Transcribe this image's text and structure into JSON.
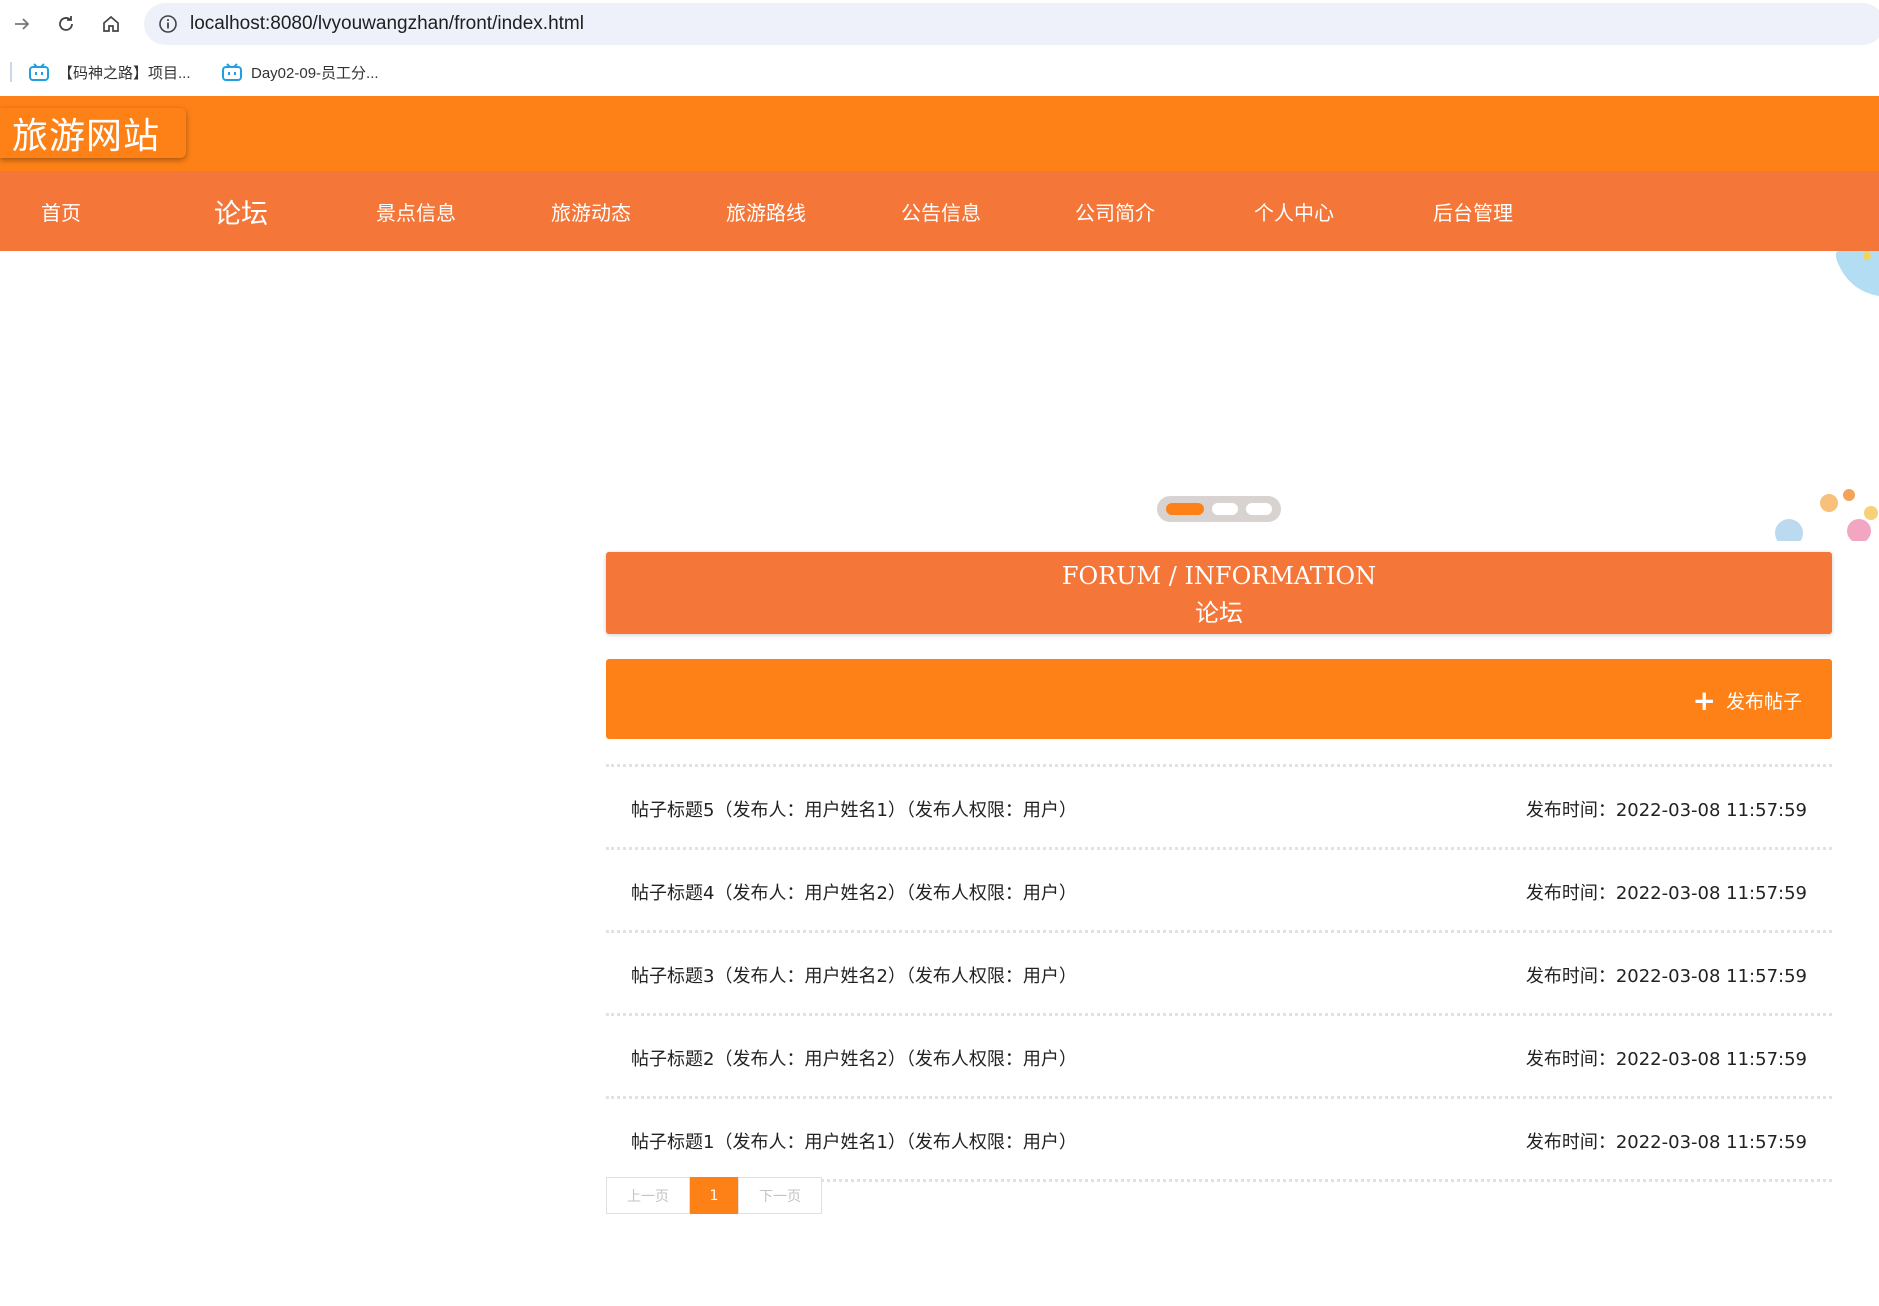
{
  "browser": {
    "url": "localhost:8080/lvyouwangzhan/front/index.html",
    "bookmarks": [
      {
        "label": "【码神之路】项目..."
      },
      {
        "label": "Day02-09-员工分..."
      }
    ]
  },
  "site": {
    "logo": "旅游网站",
    "nav": [
      {
        "label": "首页"
      },
      {
        "label": "论坛"
      },
      {
        "label": "景点信息"
      },
      {
        "label": "旅游动态"
      },
      {
        "label": "旅游路线"
      },
      {
        "label": "公告信息"
      },
      {
        "label": "公司简介"
      },
      {
        "label": "个人中心"
      },
      {
        "label": "后台管理"
      }
    ],
    "active_nav": "论坛"
  },
  "carousel": {
    "slides": 3,
    "active_slide": 1
  },
  "forum": {
    "title_en": "FORUM / INFORMATION",
    "title_cn": "论坛",
    "publish_label": "发布帖子",
    "posts": [
      {
        "title": "帖子标题5（发布人：用户姓名1）（发布人权限：用户）",
        "time": "发布时间：2022-03-08 11:57:59"
      },
      {
        "title": "帖子标题4（发布人：用户姓名2）（发布人权限：用户）",
        "time": "发布时间：2022-03-08 11:57:59"
      },
      {
        "title": "帖子标题3（发布人：用户姓名2）（发布人权限：用户）",
        "time": "发布时间：2022-03-08 11:57:59"
      },
      {
        "title": "帖子标题2（发布人：用户姓名2）（发布人权限：用户）",
        "time": "发布时间：2022-03-08 11:57:59"
      },
      {
        "title": "帖子标题1（发布人：用户姓名1）（发布人权限：用户）",
        "time": "发布时间：2022-03-08 11:57:59"
      }
    ]
  },
  "pagination": {
    "prev": "上一页",
    "current": "1",
    "next": "下一页"
  },
  "colors": {
    "primary": "#fd8117",
    "nav": "#f47638"
  }
}
